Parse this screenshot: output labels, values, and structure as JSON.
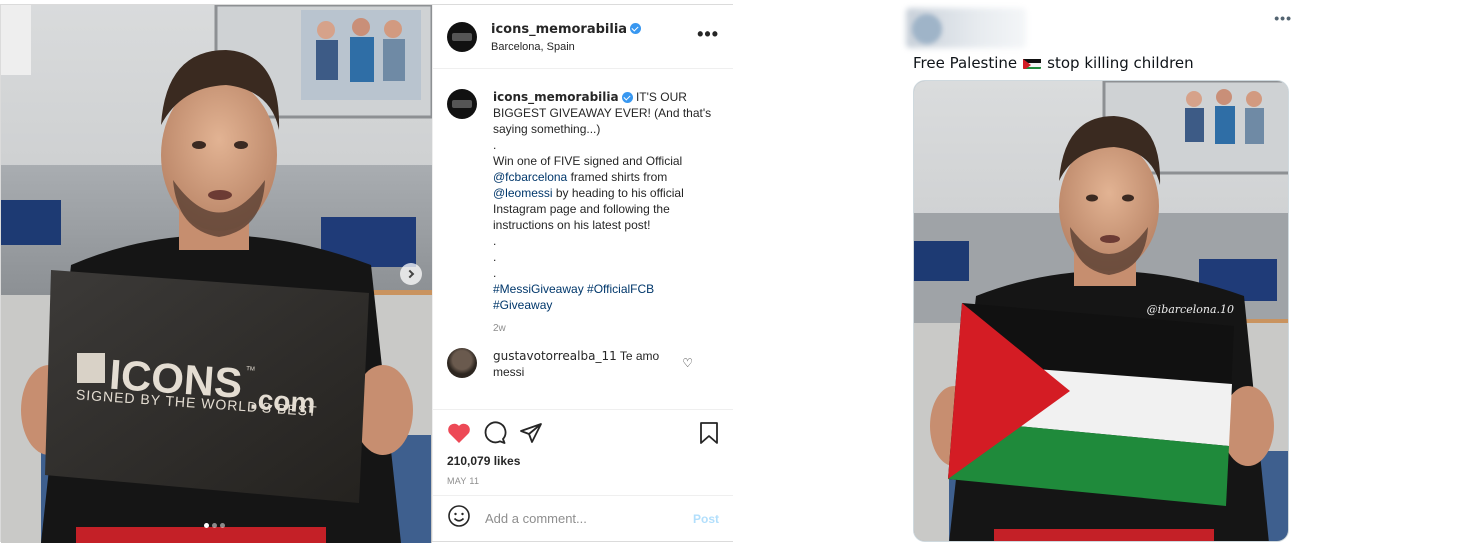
{
  "instagram": {
    "username": "icons_memorabilia",
    "location": "Barcelona, Spain",
    "caption": {
      "username": "icons_memorabilia",
      "line1": "IT'S OUR BIGGEST GIVEAWAY EVER! (And that's saying something...)",
      "dot1": ".",
      "line2a": "Win one of FIVE signed and Official ",
      "mention1": "@fcbarcelona",
      "line2b": " framed shirts from ",
      "mention2": "@leomessi",
      "line2c": " by heading to his official Instagram page and following the instructions on his latest post!",
      "dot2": ".",
      "dot3": ".",
      "dot4": ".",
      "hashtag1": "#MessiGiveaway",
      "hashtag2": "#OfficialFCB",
      "hashtag3": "#Giveaway",
      "time": "2w"
    },
    "comment": {
      "username": "gustavotorrealba_11",
      "text": "Te amo messi"
    },
    "likes": "210,079 likes",
    "date": "MAY 11",
    "add_comment_placeholder": "Add a comment...",
    "post_label": "Post",
    "more_label": "•••",
    "photo": {
      "sign_brand": "ICONS",
      "sign_domain": ".com",
      "sign_tagline": "SIGNED BY THE WORLD'S BEST",
      "sign_tm": "TM"
    },
    "colors": {
      "heart": "#ed4956",
      "verified": "#3897f0",
      "link": "#00376b"
    }
  },
  "tweet": {
    "text_before": "Free Palestine",
    "text_after": "stop killing children",
    "more_label": "•••",
    "watermark": "@ibarcelona.10",
    "flag_colors": {
      "black": "#111111",
      "white": "#f4f4f4",
      "green": "#1f8a3b",
      "red": "#d41c24"
    }
  }
}
